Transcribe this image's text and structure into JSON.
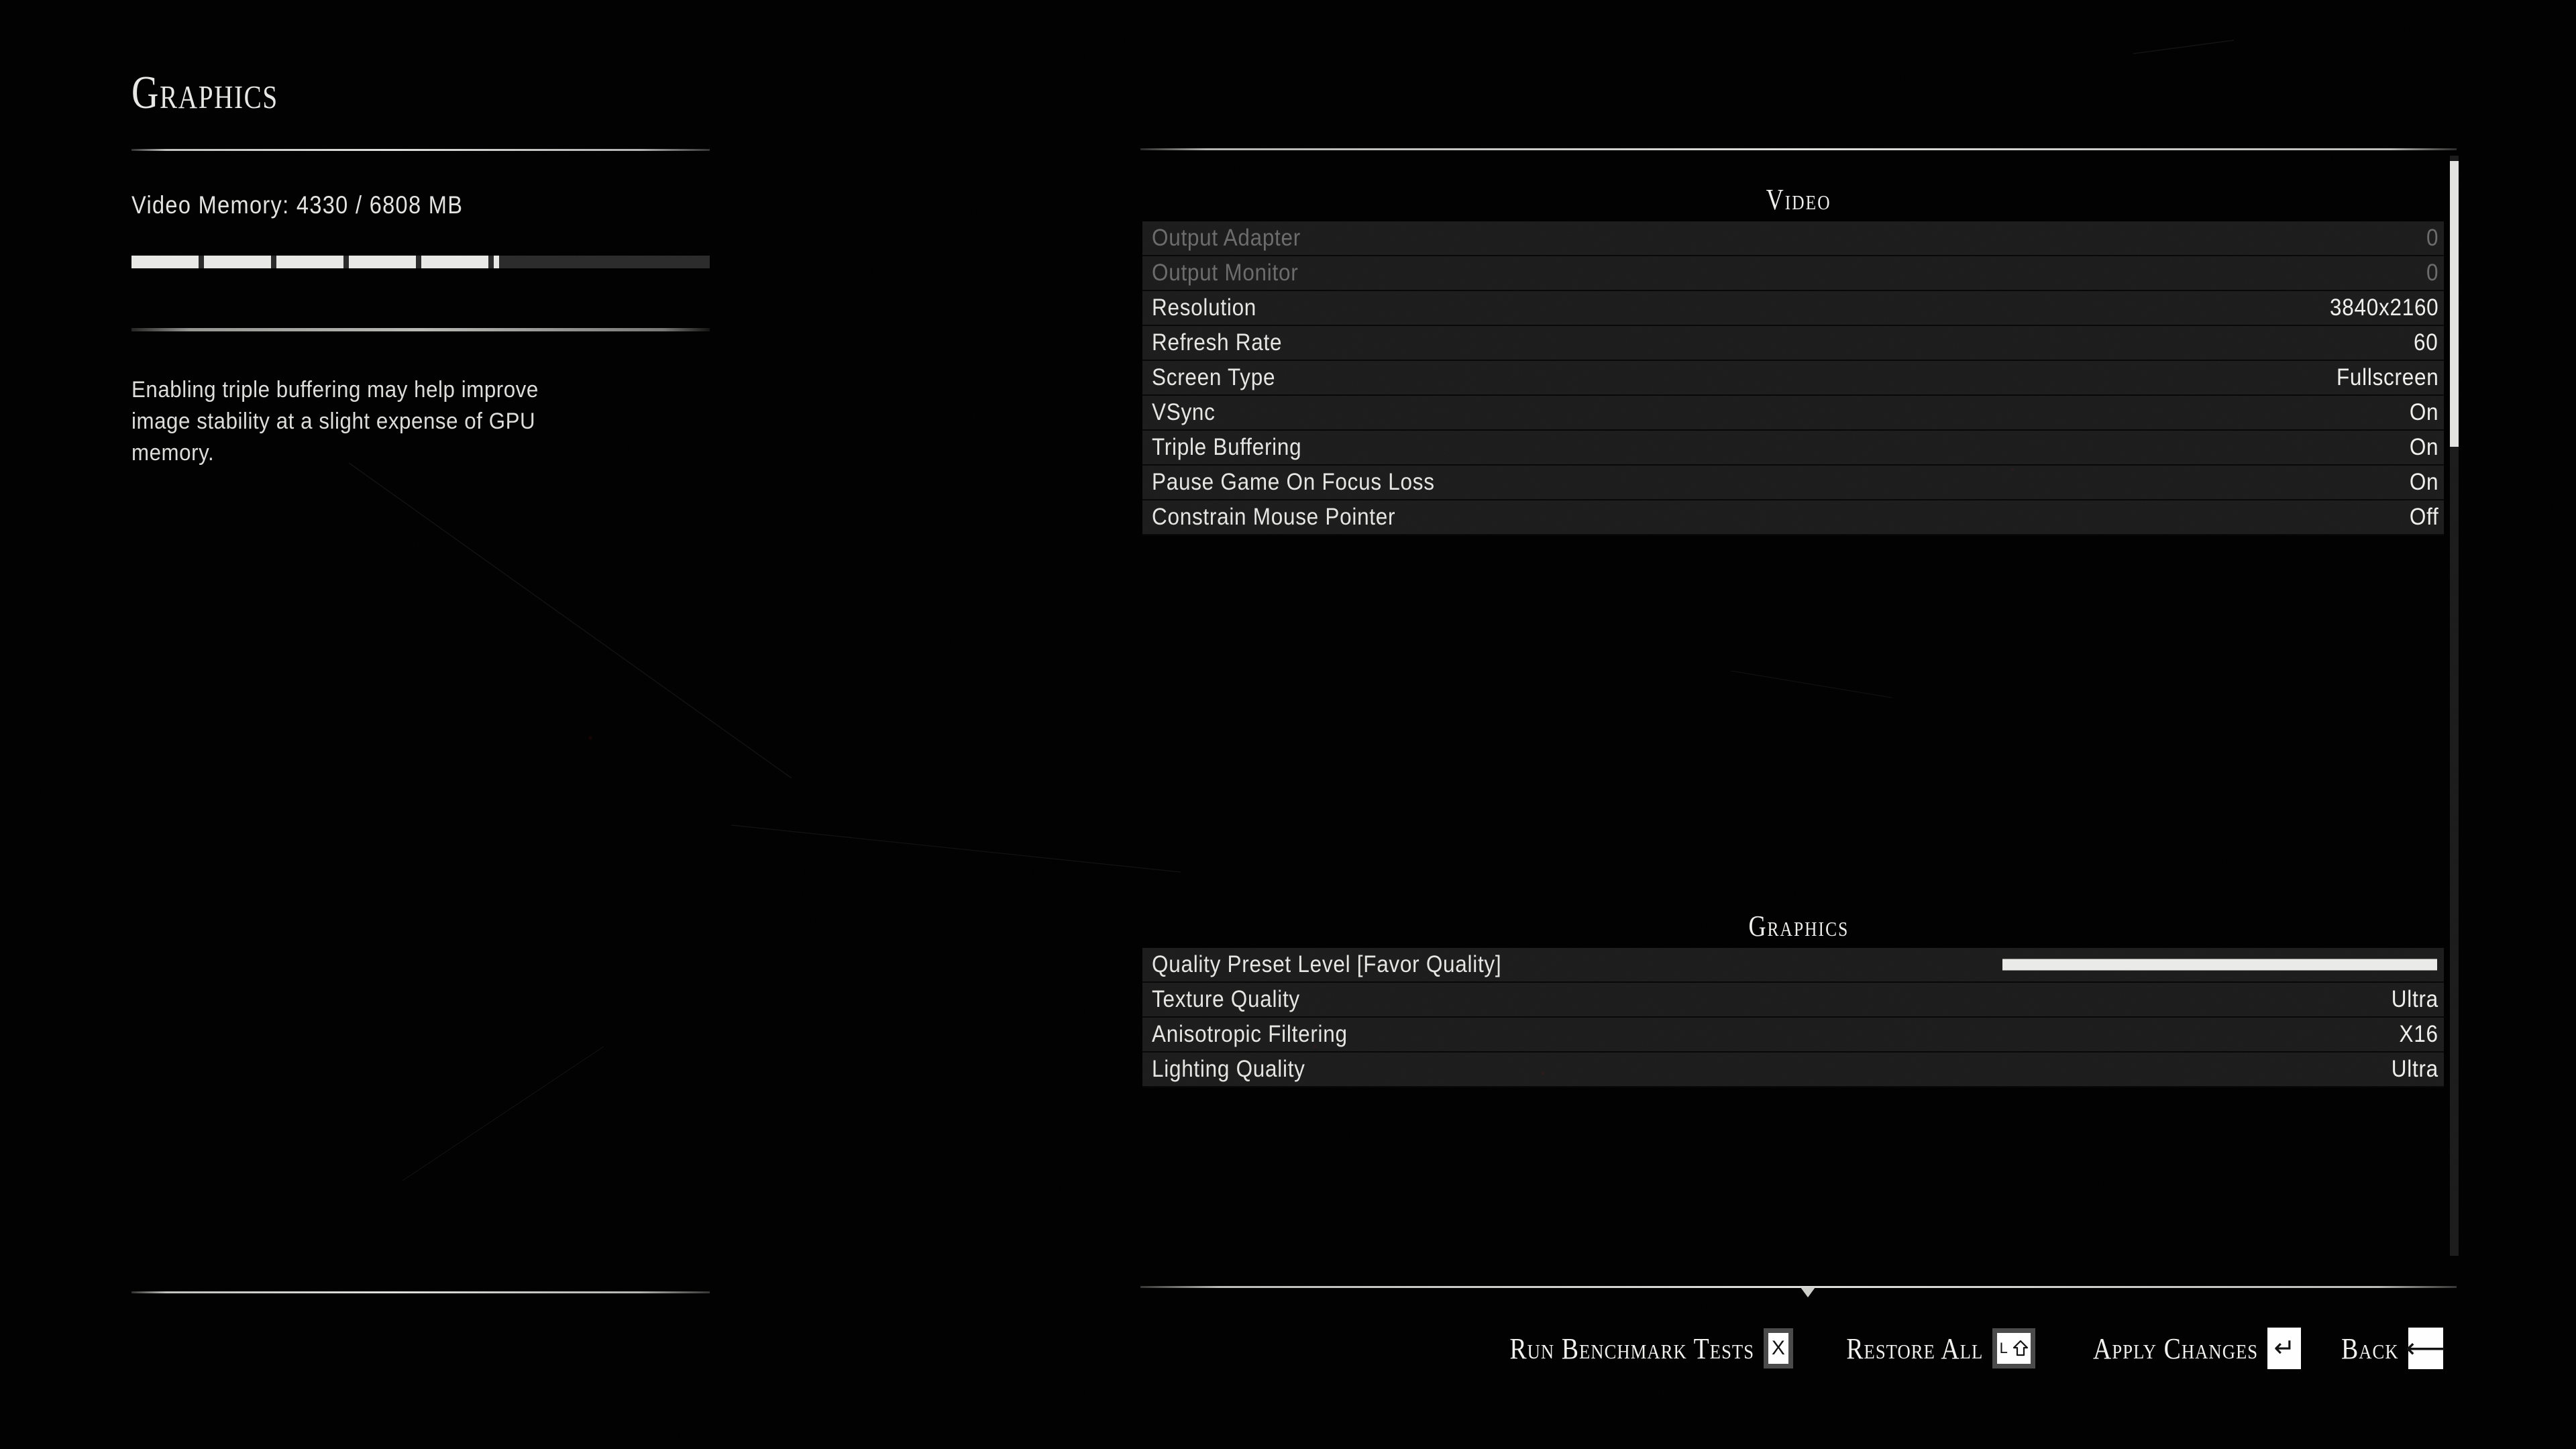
{
  "left": {
    "title": "Graphics",
    "vram_label": "Video Memory:  4330  /  6808  MB",
    "vram_used_mb": 4330,
    "vram_total_mb": 6808,
    "hint_text": "Enabling triple buffering may help improve image stability at a slight expense of GPU memory."
  },
  "sections": [
    {
      "header": "Video",
      "rows": [
        {
          "label": "Output Adapter",
          "value": "0",
          "dimmed": true,
          "type": "value"
        },
        {
          "label": "Output Monitor",
          "value": "0",
          "dimmed": true,
          "type": "value"
        },
        {
          "label": "Resolution",
          "value": "3840x2160",
          "dimmed": false,
          "type": "value"
        },
        {
          "label": "Refresh Rate",
          "value": "60",
          "dimmed": false,
          "type": "value"
        },
        {
          "label": "Screen Type",
          "value": "Fullscreen",
          "dimmed": false,
          "type": "value"
        },
        {
          "label": "VSync",
          "value": "On",
          "dimmed": false,
          "type": "value"
        },
        {
          "label": "Triple Buffering",
          "value": "On",
          "dimmed": false,
          "type": "value"
        },
        {
          "label": "Pause Game On Focus Loss",
          "value": "On",
          "dimmed": false,
          "type": "value"
        },
        {
          "label": "Constrain Mouse Pointer",
          "value": "Off",
          "dimmed": false,
          "type": "value"
        }
      ]
    },
    {
      "header": "Graphics",
      "rows": [
        {
          "label": "Quality Preset Level  [Favor Quality]",
          "value": "",
          "dimmed": false,
          "type": "slider",
          "slider_percent": 100
        },
        {
          "label": "Texture Quality",
          "value": "Ultra",
          "dimmed": false,
          "type": "value"
        },
        {
          "label": "Anisotropic Filtering",
          "value": "X16",
          "dimmed": false,
          "type": "value"
        },
        {
          "label": "Lighting Quality",
          "value": "Ultra",
          "dimmed": false,
          "type": "value"
        }
      ]
    }
  ],
  "scrollbar": {
    "thumb_position_percent": 0,
    "thumb_size_percent": 26
  },
  "bottom_actions": [
    {
      "label": "Run Benchmark Tests",
      "key_glyph": "X",
      "key_type": "x",
      "boxed": true
    },
    {
      "label": "Restore All",
      "key_glyph": "L ⇧",
      "key_type": "lshift",
      "boxed": true
    },
    {
      "label": "Apply Changes",
      "key_glyph": "↵",
      "key_type": "enter",
      "boxed": false
    },
    {
      "label": "Back",
      "key_glyph": "⟵",
      "key_type": "back",
      "boxed": false
    }
  ],
  "colors": {
    "background": "#000000",
    "row_background": "#1c1c1c",
    "row_divider": "#070707",
    "text_primary": "#ececea",
    "text_dimmed": "#6c6c6c",
    "accent_white": "#ebebe9"
  }
}
